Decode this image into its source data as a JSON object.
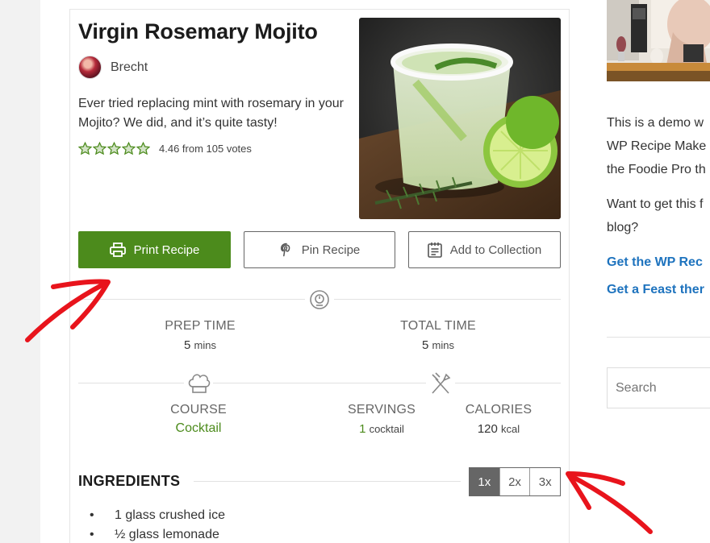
{
  "recipe": {
    "title": "Virgin Rosemary Mojito",
    "author": "Brecht",
    "summary": "Ever tried replacing mint with rosemary in your Mojito? We did, and it’s quite tasty!",
    "rating": {
      "value": 4.46,
      "text": "4.46 from 105 votes",
      "stars": 5
    },
    "buttons": {
      "print": "Print Recipe",
      "pin": "Pin Recipe",
      "collection": "Add to Collection"
    },
    "times": {
      "prep_label": "PREP TIME",
      "prep_value": "5",
      "prep_unit": "mins",
      "total_label": "TOTAL TIME",
      "total_value": "5",
      "total_unit": "mins"
    },
    "details": {
      "course_label": "COURSE",
      "course_value": "Cocktail",
      "servings_label": "SERVINGS",
      "servings_value": "1",
      "servings_unit": "cocktail",
      "calories_label": "CALORIES",
      "calories_value": "120",
      "calories_unit": "kcal"
    },
    "ingredients": {
      "title": "INGREDIENTS",
      "multipliers": [
        "1x",
        "2x",
        "3x"
      ],
      "active_multiplier": "1x",
      "items": [
        "1 glass crushed ice",
        "½ glass lemonade"
      ]
    }
  },
  "sidebar": {
    "text_lines": [
      "This is a demo w",
      "WP Recipe Make",
      "the Foodie Pro th"
    ],
    "text2_lines": [
      "Want to get this f",
      "blog?"
    ],
    "links": [
      "Get the WP Rec",
      "Get a Feast ther"
    ],
    "search_placeholder": "Search"
  },
  "colors": {
    "accent_green": "#4c8b1c",
    "link_blue": "#1e73be",
    "annotation_red": "#e8141c"
  }
}
